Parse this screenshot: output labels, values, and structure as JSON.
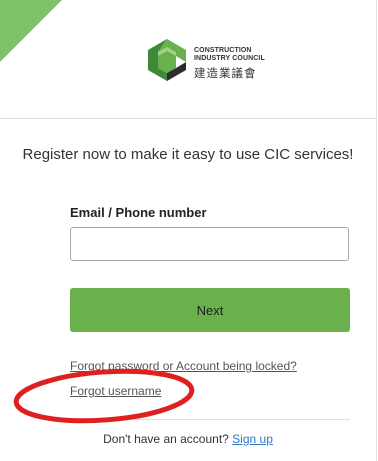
{
  "logo": {
    "text_line1": "CONSTRUCTION",
    "text_line2": "INDUSTRY COUNCIL",
    "text_chinese": "建造業議會"
  },
  "title": "Register now to make it easy to use CIC services!",
  "email_field": {
    "label": "Email / Phone number",
    "value": "",
    "placeholder": ""
  },
  "next_button": {
    "label": "Next"
  },
  "links": {
    "forgot_password": "Forgot password or Account being locked?",
    "forgot_username": "Forgot username"
  },
  "signup": {
    "prompt": "Don't have an account?",
    "link": "Sign up"
  },
  "colors": {
    "accent_green": "#6ab04c",
    "link_blue": "#2b7ac8",
    "annotation_red": "#e02020"
  }
}
